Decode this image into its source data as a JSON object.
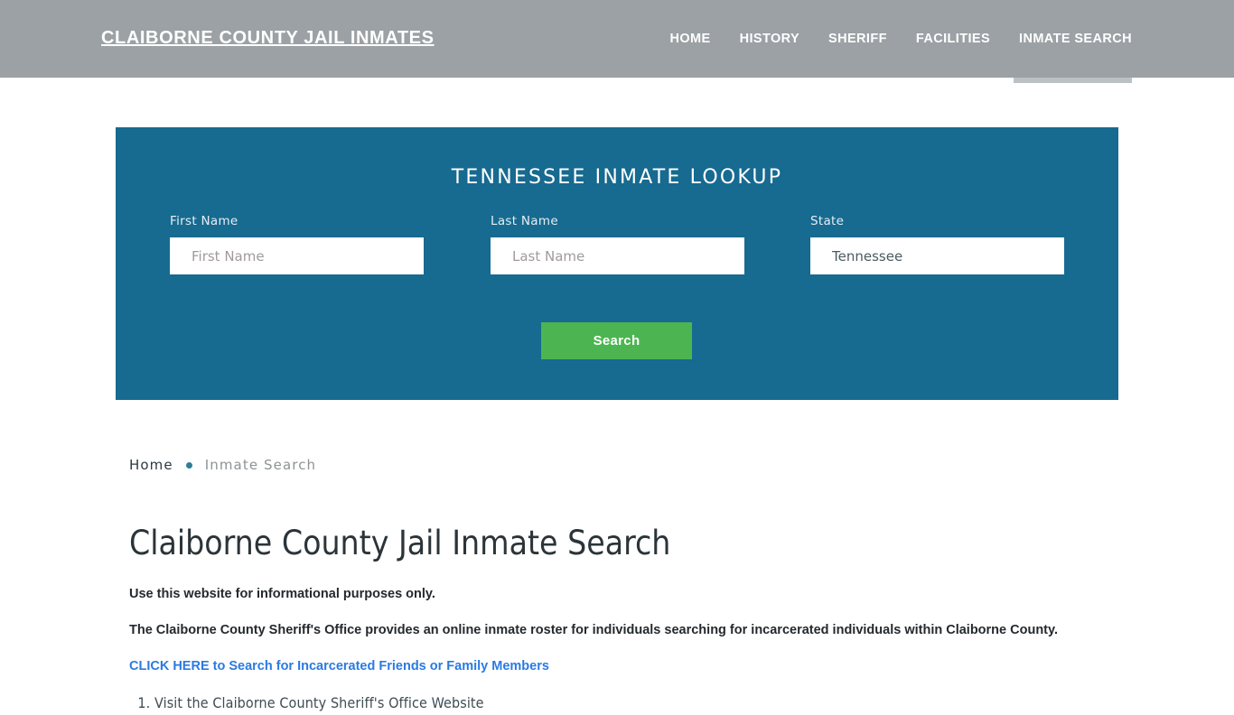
{
  "header": {
    "brand": "CLAIBORNE COUNTY JAIL INMATES",
    "nav": [
      {
        "label": "HOME",
        "active": false
      },
      {
        "label": "HISTORY",
        "active": false
      },
      {
        "label": "SHERIFF",
        "active": false
      },
      {
        "label": "FACILITIES",
        "active": false
      },
      {
        "label": "INMATE SEARCH",
        "active": true
      }
    ],
    "background_color": "#9ba1a4",
    "active_indicator_color": "#bcc1c4"
  },
  "lookup": {
    "title": "TENNESSEE INMATE LOOKUP",
    "panel_color": "#176a90",
    "first_name": {
      "label": "First Name",
      "placeholder": "First Name",
      "value": ""
    },
    "last_name": {
      "label": "Last Name",
      "placeholder": "Last Name",
      "value": ""
    },
    "state": {
      "label": "State",
      "placeholder": "Tennessee",
      "value": "Tennessee"
    },
    "search_button": {
      "label": "Search",
      "color": "#4cb551"
    }
  },
  "breadcrumb": {
    "home": "Home",
    "separator": "•",
    "current": "Inmate Search",
    "separator_color": "#2f7e99"
  },
  "main": {
    "title": "Claiborne County Jail Inmate Search",
    "paragraph_1": "Use this website for informational purposes only.",
    "paragraph_2": "The Claiborne County Sheriff's Office provides an online inmate roster for individuals searching for incarcerated individuals within Claiborne County.",
    "link_text": "CLICK HERE to Search for Incarcerated Friends or Family Members",
    "link_color": "#2a7ae2",
    "steps": [
      "Visit the Claiborne County Sheriff's Office Website"
    ]
  }
}
